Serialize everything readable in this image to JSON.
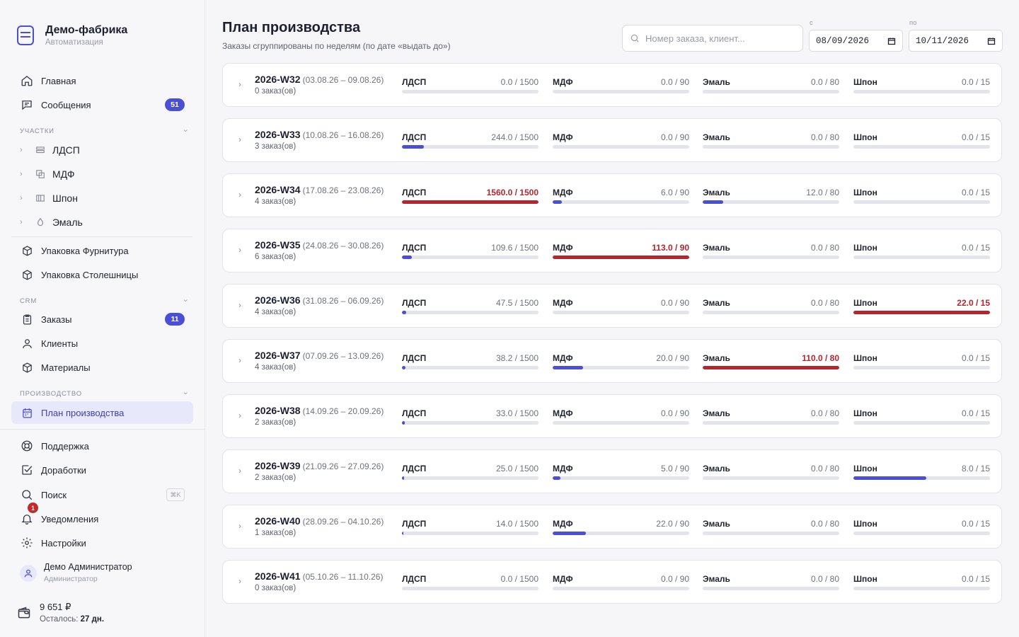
{
  "brand": {
    "title": "Демо-фабрика",
    "subtitle": "Автоматизация"
  },
  "nav_top": [
    {
      "label": "Главная",
      "icon": "home-icon"
    },
    {
      "label": "Сообщения",
      "icon": "message-icon",
      "badge": "51"
    }
  ],
  "sections": {
    "areas": "УЧАСТКИ",
    "crm": "CRM",
    "production": "ПРОИЗВОДСТВО"
  },
  "areas": [
    {
      "label": "ЛДСП",
      "icon": "layers-icon"
    },
    {
      "label": "МДФ",
      "icon": "copy-icon"
    },
    {
      "label": "Шпон",
      "icon": "columns-icon"
    },
    {
      "label": "Эмаль",
      "icon": "drop-icon"
    }
  ],
  "packaging": [
    {
      "label": "Упаковка Фурнитура",
      "icon": "box-icon"
    },
    {
      "label": "Упаковка Столешницы",
      "icon": "box-icon"
    }
  ],
  "crm_items": [
    {
      "label": "Заказы",
      "icon": "clipboard-icon",
      "badge": "11"
    },
    {
      "label": "Клиенты",
      "icon": "user-icon"
    },
    {
      "label": "Материалы",
      "icon": "box-icon"
    }
  ],
  "production_items": [
    {
      "label": "План производства",
      "icon": "calendar-icon"
    }
  ],
  "bottom_nav": [
    {
      "label": "Поддержка",
      "icon": "lifebuoy-icon"
    },
    {
      "label": "Доработки",
      "icon": "checkbox-icon"
    },
    {
      "label": "Поиск",
      "icon": "search-icon",
      "shortcut": "⌘K"
    },
    {
      "label": "Уведомления",
      "icon": "bell-icon",
      "dot": "1"
    },
    {
      "label": "Настройки",
      "icon": "gear-icon"
    }
  ],
  "user": {
    "name": "Демо Администратор",
    "role": "Администратор"
  },
  "wallet": {
    "amount": "9 651 ₽",
    "left_label": "Осталось:",
    "left_value": "27 дн."
  },
  "page": {
    "title": "План производства",
    "subtitle": "Заказы сгруппированы по неделям (по дате «выдать до»)",
    "search_placeholder": "Номер заказа, клиент...",
    "date_from_label": "с",
    "date_from": "08/09/2026",
    "date_to_label": "по",
    "date_to": "10/11/2026"
  },
  "metric_names": [
    "ЛДСП",
    "МДФ",
    "Эмаль",
    "Шпон"
  ],
  "capacities": [
    1500,
    90,
    80,
    15
  ],
  "colors": {
    "accent": "#4b4fd6",
    "over": "#b3262e",
    "track": "#e4e4ec"
  },
  "weeks": [
    {
      "code": "2026-W32",
      "range": "(03.08.26 – 09.08.26)",
      "orders": "0 заказ(ов)",
      "values": [
        "0.0 / 1500",
        "0.0 / 90",
        "0.0 / 80",
        "0.0 / 15"
      ],
      "loads": [
        0,
        0,
        0,
        0
      ]
    },
    {
      "code": "2026-W33",
      "range": "(10.08.26 – 16.08.26)",
      "orders": "3 заказ(ов)",
      "values": [
        "244.0 / 1500",
        "0.0 / 90",
        "0.0 / 80",
        "0.0 / 15"
      ],
      "loads": [
        244.0,
        0,
        0,
        0
      ]
    },
    {
      "code": "2026-W34",
      "range": "(17.08.26 – 23.08.26)",
      "orders": "4 заказ(ов)",
      "values": [
        "1560.0 / 1500",
        "6.0 / 90",
        "12.0 / 80",
        "0.0 / 15"
      ],
      "loads": [
        1560.0,
        6.0,
        12.0,
        0
      ]
    },
    {
      "code": "2026-W35",
      "range": "(24.08.26 – 30.08.26)",
      "orders": "6 заказ(ов)",
      "values": [
        "109.6 / 1500",
        "113.0 / 90",
        "0.0 / 80",
        "0.0 / 15"
      ],
      "loads": [
        109.6,
        113.0,
        0,
        0
      ]
    },
    {
      "code": "2026-W36",
      "range": "(31.08.26 – 06.09.26)",
      "orders": "4 заказ(ов)",
      "values": [
        "47.5 / 1500",
        "0.0 / 90",
        "0.0 / 80",
        "22.0 / 15"
      ],
      "loads": [
        47.5,
        0,
        0,
        22.0
      ]
    },
    {
      "code": "2026-W37",
      "range": "(07.09.26 – 13.09.26)",
      "orders": "4 заказ(ов)",
      "values": [
        "38.2 / 1500",
        "20.0 / 90",
        "110.0 / 80",
        "0.0 / 15"
      ],
      "loads": [
        38.2,
        20.0,
        110.0,
        0
      ]
    },
    {
      "code": "2026-W38",
      "range": "(14.09.26 – 20.09.26)",
      "orders": "2 заказ(ов)",
      "values": [
        "33.0 / 1500",
        "0.0 / 90",
        "0.0 / 80",
        "0.0 / 15"
      ],
      "loads": [
        33.0,
        0,
        0,
        0
      ]
    },
    {
      "code": "2026-W39",
      "range": "(21.09.26 – 27.09.26)",
      "orders": "2 заказ(ов)",
      "values": [
        "25.0 / 1500",
        "5.0 / 90",
        "0.0 / 80",
        "8.0 / 15"
      ],
      "loads": [
        25.0,
        5.0,
        0,
        8.0
      ]
    },
    {
      "code": "2026-W40",
      "range": "(28.09.26 – 04.10.26)",
      "orders": "1 заказ(ов)",
      "values": [
        "14.0 / 1500",
        "22.0 / 90",
        "0.0 / 80",
        "0.0 / 15"
      ],
      "loads": [
        14.0,
        22.0,
        0,
        0
      ]
    },
    {
      "code": "2026-W41",
      "range": "(05.10.26 – 11.10.26)",
      "orders": "0 заказ(ов)",
      "values": [
        "0.0 / 1500",
        "0.0 / 90",
        "0.0 / 80",
        "0.0 / 15"
      ],
      "loads": [
        0,
        0,
        0,
        0
      ]
    }
  ]
}
